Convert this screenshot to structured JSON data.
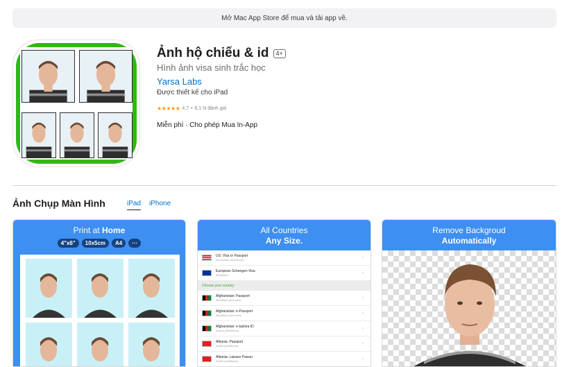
{
  "banner": {
    "text": "Mở Mac App Store để mua và tải app về."
  },
  "app": {
    "title": "Ảnh hộ chiếu & id",
    "age_rating": "4+",
    "subtitle": "Hình ảnh visa sinh trắc học",
    "developer": "Yarsa Labs",
    "designed_for": "Được thiết kế cho iPad",
    "rating_stars": "★★★★★",
    "rating_value": "4,7",
    "rating_count": "6,1 N đánh giá",
    "price": "Miễn phí · Cho phép Mua In-App"
  },
  "screenshots_section": {
    "title": "Ảnh Chụp Màn Hình",
    "tabs": [
      {
        "label": "iPad",
        "active": true
      },
      {
        "label": "iPhone",
        "active": false
      }
    ]
  },
  "shot1": {
    "heading_line1_a": "Print at ",
    "heading_line1_b": "Home",
    "chips": [
      "4\"x6\"",
      "10x5cm",
      "A4",
      "···"
    ]
  },
  "shot2": {
    "heading_line1": "All Countries",
    "heading_line2": "Any Size.",
    "rows": [
      {
        "label": "US: Visa or Passport",
        "sub": "2x2 inches (51x51mm)",
        "flag": "us"
      },
      {
        "label": "European Schengen Visa",
        "sub": "35x45mm",
        "flag": "eu"
      },
      {
        "label": "Choose your country",
        "header": true
      },
      {
        "label": "Afghanistan: Passport",
        "sub": "35x45mm (4x4 inch)",
        "flag": "af"
      },
      {
        "label": "Afghanistan: e-Passport",
        "sub": "35x45mm (4x4 inch)",
        "flag": "af"
      },
      {
        "label": "Afghanistan: e-tazkira ID",
        "sub": "3x4cm (30x40mm)",
        "flag": "af"
      },
      {
        "label": "Albania: Passport",
        "sub": "40x50 (40x50mm)",
        "flag": "al"
      },
      {
        "label": "Albania: Laissez Passer",
        "sub": "40x50 (40x50mm)",
        "flag": "al"
      }
    ]
  },
  "shot3": {
    "heading_line1": "Remove Backgroud",
    "heading_line2": "Automatically"
  },
  "colors": {
    "accent": "#0070c9",
    "shot_bg": "#3d8ff2",
    "icon_green": "#34b517"
  }
}
